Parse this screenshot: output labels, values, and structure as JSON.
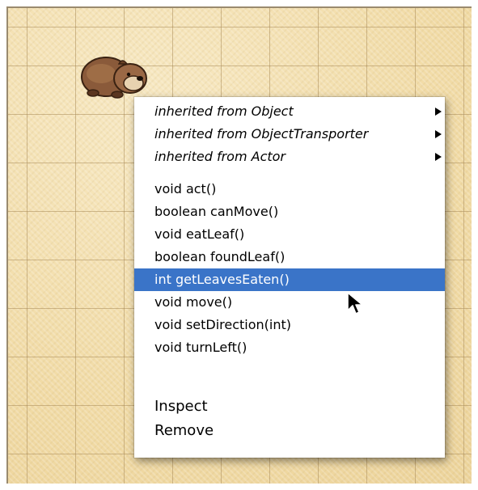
{
  "world": {
    "actor": "wombat"
  },
  "context_menu": {
    "submenus": [
      {
        "label": "inherited from Object"
      },
      {
        "label": "inherited from ObjectTransporter"
      },
      {
        "label": "inherited from Actor"
      }
    ],
    "methods": [
      {
        "label": "void act()"
      },
      {
        "label": "boolean canMove()"
      },
      {
        "label": "void eatLeaf()"
      },
      {
        "label": "boolean foundLeaf()"
      },
      {
        "label": "int getLeavesEaten()",
        "highlighted": true
      },
      {
        "label": "void move()"
      },
      {
        "label": "void setDirection(int)"
      },
      {
        "label": "void turnLeft()"
      }
    ],
    "actions": [
      {
        "label": "Inspect"
      },
      {
        "label": "Remove"
      }
    ],
    "highlight_color": "#3a74c8"
  }
}
